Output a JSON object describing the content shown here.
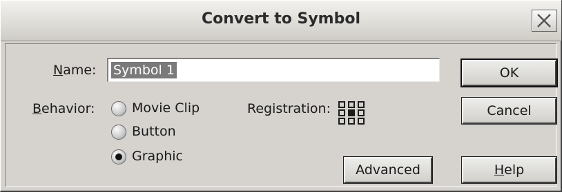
{
  "dialog": {
    "title": "Convert to Symbol",
    "close_icon": "close-x-icon"
  },
  "form": {
    "name_label_mnemonic": "N",
    "name_label_rest": "ame:",
    "name_value": "Symbol 1",
    "behavior_label_mnemonic": "B",
    "behavior_label_rest": "ehavior:",
    "behaviors": [
      {
        "label": "Movie Clip",
        "checked": false
      },
      {
        "label": "Button",
        "checked": false
      },
      {
        "label": "Graphic",
        "checked": true
      }
    ],
    "registration_label": "Registration:",
    "registration_selected": "center"
  },
  "buttons": {
    "ok": "OK",
    "cancel": "Cancel",
    "advanced": "Advanced",
    "help_mnemonic": "H",
    "help_rest": "elp"
  }
}
